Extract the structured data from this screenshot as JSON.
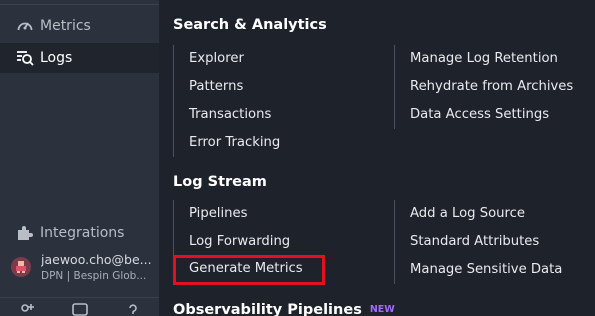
{
  "sidebar": {
    "metrics_label": "Metrics",
    "logs_label": "Logs",
    "integrations_label": "Integrations",
    "user": {
      "name": "jaewoo.cho@be...",
      "org": "DPN | Bespin Glob..."
    }
  },
  "panel": {
    "sections": [
      {
        "title": "Search & Analytics",
        "left": [
          "Explorer",
          "Patterns",
          "Transactions",
          "Error Tracking"
        ],
        "right": [
          "Manage Log Retention",
          "Rehydrate from Archives",
          "Data Access Settings"
        ]
      },
      {
        "title": "Log Stream",
        "left": [
          "Pipelines",
          "Log Forwarding",
          "Generate Metrics"
        ],
        "right": [
          "Add a Log Source",
          "Standard Attributes",
          "Manage Sensitive Data"
        ]
      },
      {
        "title": "Observability Pipelines",
        "badge": "NEW"
      }
    ]
  },
  "colors": {
    "sidebar_bg": "#2b323d",
    "panel_bg": "#1e232b",
    "highlight": "#e3101f",
    "badge": "#a26bff"
  }
}
